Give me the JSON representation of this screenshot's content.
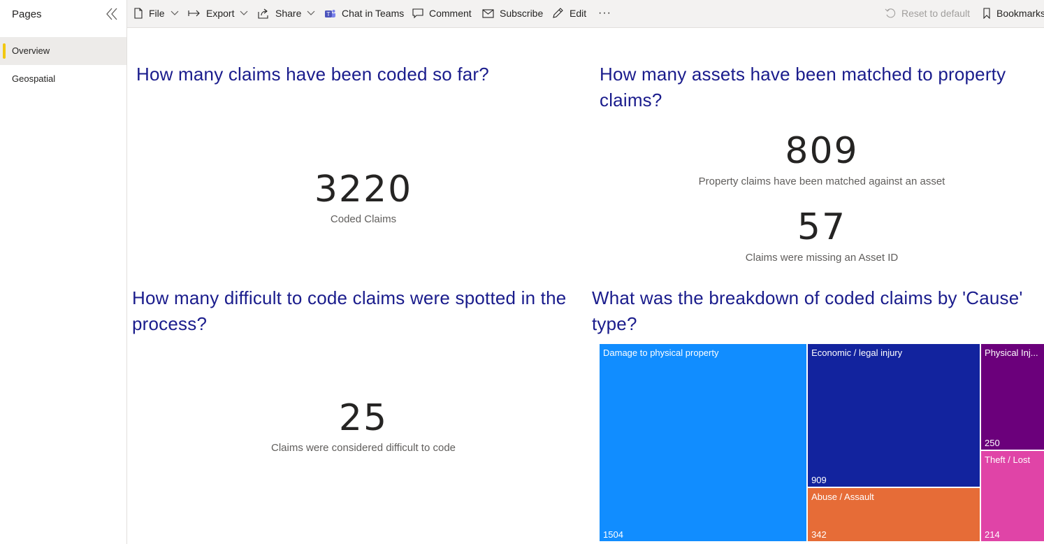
{
  "sidebar": {
    "title": "Pages",
    "items": [
      {
        "label": "Overview"
      },
      {
        "label": "Geospatial"
      }
    ]
  },
  "toolbar": {
    "file": "File",
    "export": "Export",
    "share": "Share",
    "chat_in_teams": "Chat in Teams",
    "comment": "Comment",
    "subscribe": "Subscribe",
    "edit": "Edit",
    "more": "···",
    "reset_to_default": "Reset to default",
    "bookmarks": "Bookmarks"
  },
  "visuals": {
    "coded": {
      "question": "How many claims have been coded so far?",
      "value": "3220",
      "label": "Coded Claims"
    },
    "assets": {
      "question": "How many assets have been matched to property claims?",
      "value1": "809",
      "label1": "Property claims have been matched against an asset",
      "value2": "57",
      "label2": "Claims were missing an Asset ID"
    },
    "difficult": {
      "question": "How many difficult to code claims were spotted in the process?",
      "value": "25",
      "label": "Claims were considered difficult to code"
    },
    "breakdown": {
      "question": "What was the breakdown of coded claims by 'Cause' type?"
    }
  },
  "chart_data": {
    "type": "treemap",
    "items": [
      {
        "name": "Damage to physical property",
        "display_name": "Damage to physical property",
        "value": 1504,
        "color": "#118dff"
      },
      {
        "name": "Economic / legal injury",
        "display_name": "Economic / legal injury",
        "value": 909,
        "color": "#12239e"
      },
      {
        "name": "Abuse / Assault",
        "display_name": "Abuse / Assault",
        "value": 342,
        "color": "#e66c37"
      },
      {
        "name": "Physical Injury",
        "display_name": "Physical Inj...",
        "value": 250,
        "color": "#6b007b"
      },
      {
        "name": "Theft / Lost",
        "display_name": "Theft / Lost",
        "value": 214,
        "color": "#e044a7"
      }
    ]
  },
  "colors": {
    "accent": "#f2c811",
    "question_text": "#1a1c8c"
  }
}
